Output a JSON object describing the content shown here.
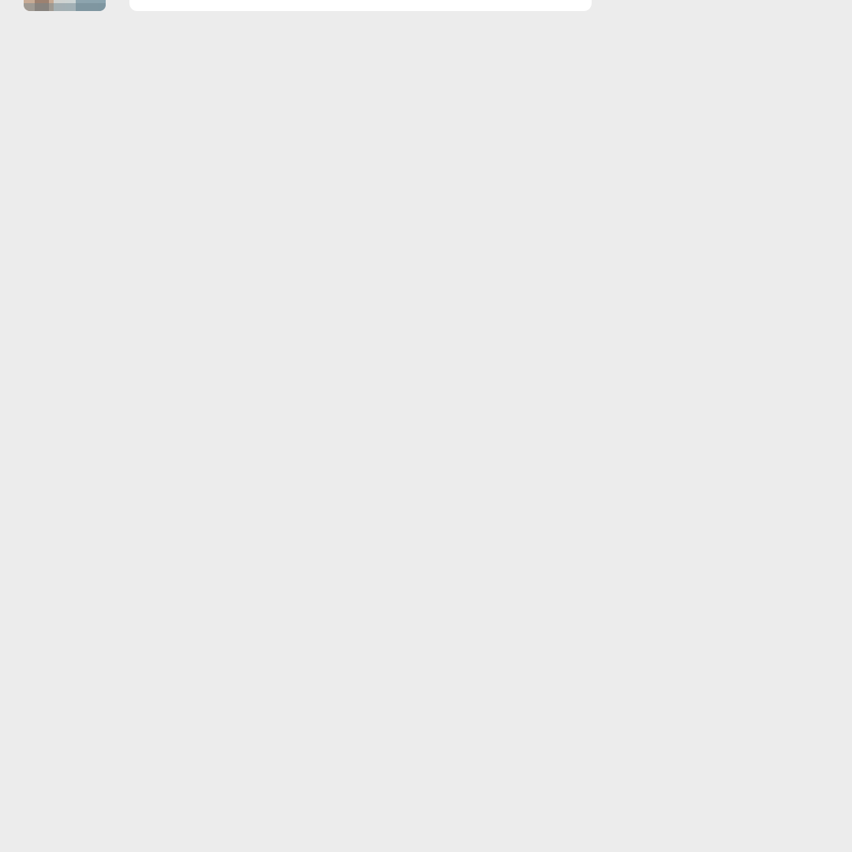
{
  "feed": {
    "items": [
      {
        "thumbnail_icon": "photo-thumbnail"
      }
    ]
  },
  "colors": {
    "background": "#ececec",
    "card": "#ffffff"
  }
}
